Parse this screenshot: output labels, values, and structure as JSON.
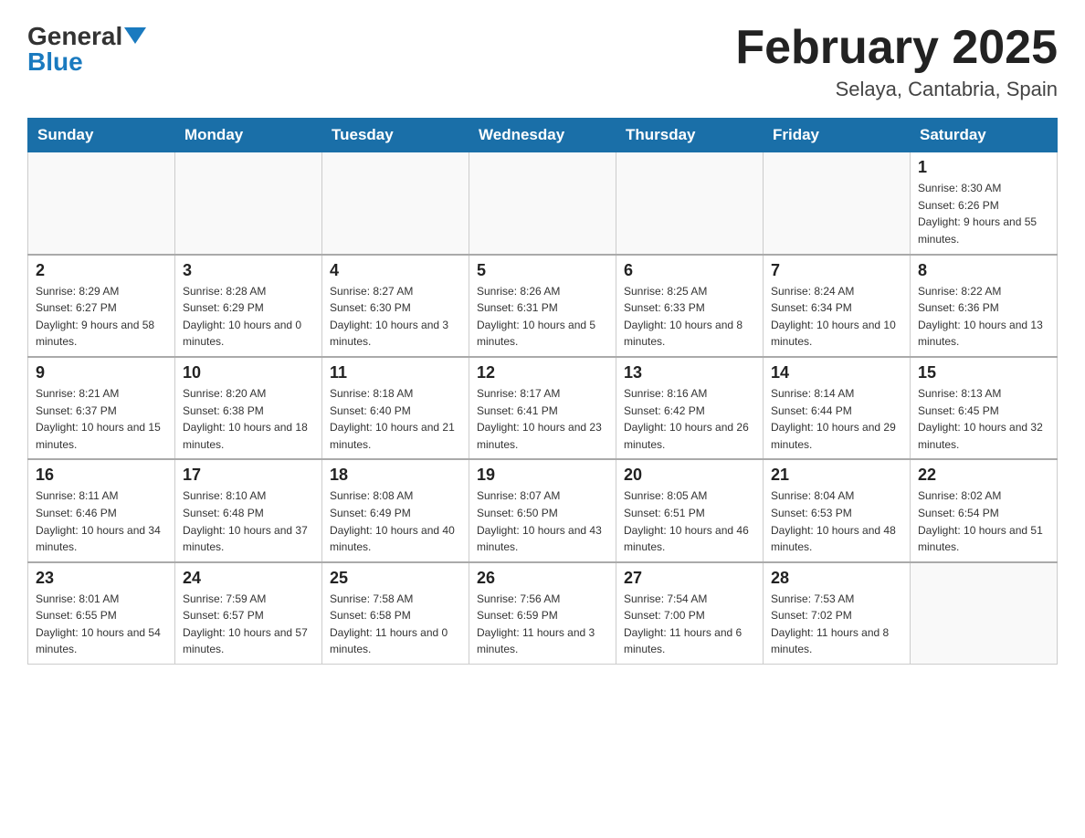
{
  "header": {
    "logo_general": "General",
    "logo_blue": "Blue",
    "title": "February 2025",
    "subtitle": "Selaya, Cantabria, Spain"
  },
  "days_of_week": [
    "Sunday",
    "Monday",
    "Tuesday",
    "Wednesday",
    "Thursday",
    "Friday",
    "Saturday"
  ],
  "weeks": [
    [
      {
        "day": "",
        "info": ""
      },
      {
        "day": "",
        "info": ""
      },
      {
        "day": "",
        "info": ""
      },
      {
        "day": "",
        "info": ""
      },
      {
        "day": "",
        "info": ""
      },
      {
        "day": "",
        "info": ""
      },
      {
        "day": "1",
        "info": "Sunrise: 8:30 AM\nSunset: 6:26 PM\nDaylight: 9 hours and 55 minutes."
      }
    ],
    [
      {
        "day": "2",
        "info": "Sunrise: 8:29 AM\nSunset: 6:27 PM\nDaylight: 9 hours and 58 minutes."
      },
      {
        "day": "3",
        "info": "Sunrise: 8:28 AM\nSunset: 6:29 PM\nDaylight: 10 hours and 0 minutes."
      },
      {
        "day": "4",
        "info": "Sunrise: 8:27 AM\nSunset: 6:30 PM\nDaylight: 10 hours and 3 minutes."
      },
      {
        "day": "5",
        "info": "Sunrise: 8:26 AM\nSunset: 6:31 PM\nDaylight: 10 hours and 5 minutes."
      },
      {
        "day": "6",
        "info": "Sunrise: 8:25 AM\nSunset: 6:33 PM\nDaylight: 10 hours and 8 minutes."
      },
      {
        "day": "7",
        "info": "Sunrise: 8:24 AM\nSunset: 6:34 PM\nDaylight: 10 hours and 10 minutes."
      },
      {
        "day": "8",
        "info": "Sunrise: 8:22 AM\nSunset: 6:36 PM\nDaylight: 10 hours and 13 minutes."
      }
    ],
    [
      {
        "day": "9",
        "info": "Sunrise: 8:21 AM\nSunset: 6:37 PM\nDaylight: 10 hours and 15 minutes."
      },
      {
        "day": "10",
        "info": "Sunrise: 8:20 AM\nSunset: 6:38 PM\nDaylight: 10 hours and 18 minutes."
      },
      {
        "day": "11",
        "info": "Sunrise: 8:18 AM\nSunset: 6:40 PM\nDaylight: 10 hours and 21 minutes."
      },
      {
        "day": "12",
        "info": "Sunrise: 8:17 AM\nSunset: 6:41 PM\nDaylight: 10 hours and 23 minutes."
      },
      {
        "day": "13",
        "info": "Sunrise: 8:16 AM\nSunset: 6:42 PM\nDaylight: 10 hours and 26 minutes."
      },
      {
        "day": "14",
        "info": "Sunrise: 8:14 AM\nSunset: 6:44 PM\nDaylight: 10 hours and 29 minutes."
      },
      {
        "day": "15",
        "info": "Sunrise: 8:13 AM\nSunset: 6:45 PM\nDaylight: 10 hours and 32 minutes."
      }
    ],
    [
      {
        "day": "16",
        "info": "Sunrise: 8:11 AM\nSunset: 6:46 PM\nDaylight: 10 hours and 34 minutes."
      },
      {
        "day": "17",
        "info": "Sunrise: 8:10 AM\nSunset: 6:48 PM\nDaylight: 10 hours and 37 minutes."
      },
      {
        "day": "18",
        "info": "Sunrise: 8:08 AM\nSunset: 6:49 PM\nDaylight: 10 hours and 40 minutes."
      },
      {
        "day": "19",
        "info": "Sunrise: 8:07 AM\nSunset: 6:50 PM\nDaylight: 10 hours and 43 minutes."
      },
      {
        "day": "20",
        "info": "Sunrise: 8:05 AM\nSunset: 6:51 PM\nDaylight: 10 hours and 46 minutes."
      },
      {
        "day": "21",
        "info": "Sunrise: 8:04 AM\nSunset: 6:53 PM\nDaylight: 10 hours and 48 minutes."
      },
      {
        "day": "22",
        "info": "Sunrise: 8:02 AM\nSunset: 6:54 PM\nDaylight: 10 hours and 51 minutes."
      }
    ],
    [
      {
        "day": "23",
        "info": "Sunrise: 8:01 AM\nSunset: 6:55 PM\nDaylight: 10 hours and 54 minutes."
      },
      {
        "day": "24",
        "info": "Sunrise: 7:59 AM\nSunset: 6:57 PM\nDaylight: 10 hours and 57 minutes."
      },
      {
        "day": "25",
        "info": "Sunrise: 7:58 AM\nSunset: 6:58 PM\nDaylight: 11 hours and 0 minutes."
      },
      {
        "day": "26",
        "info": "Sunrise: 7:56 AM\nSunset: 6:59 PM\nDaylight: 11 hours and 3 minutes."
      },
      {
        "day": "27",
        "info": "Sunrise: 7:54 AM\nSunset: 7:00 PM\nDaylight: 11 hours and 6 minutes."
      },
      {
        "day": "28",
        "info": "Sunrise: 7:53 AM\nSunset: 7:02 PM\nDaylight: 11 hours and 8 minutes."
      },
      {
        "day": "",
        "info": ""
      }
    ]
  ]
}
